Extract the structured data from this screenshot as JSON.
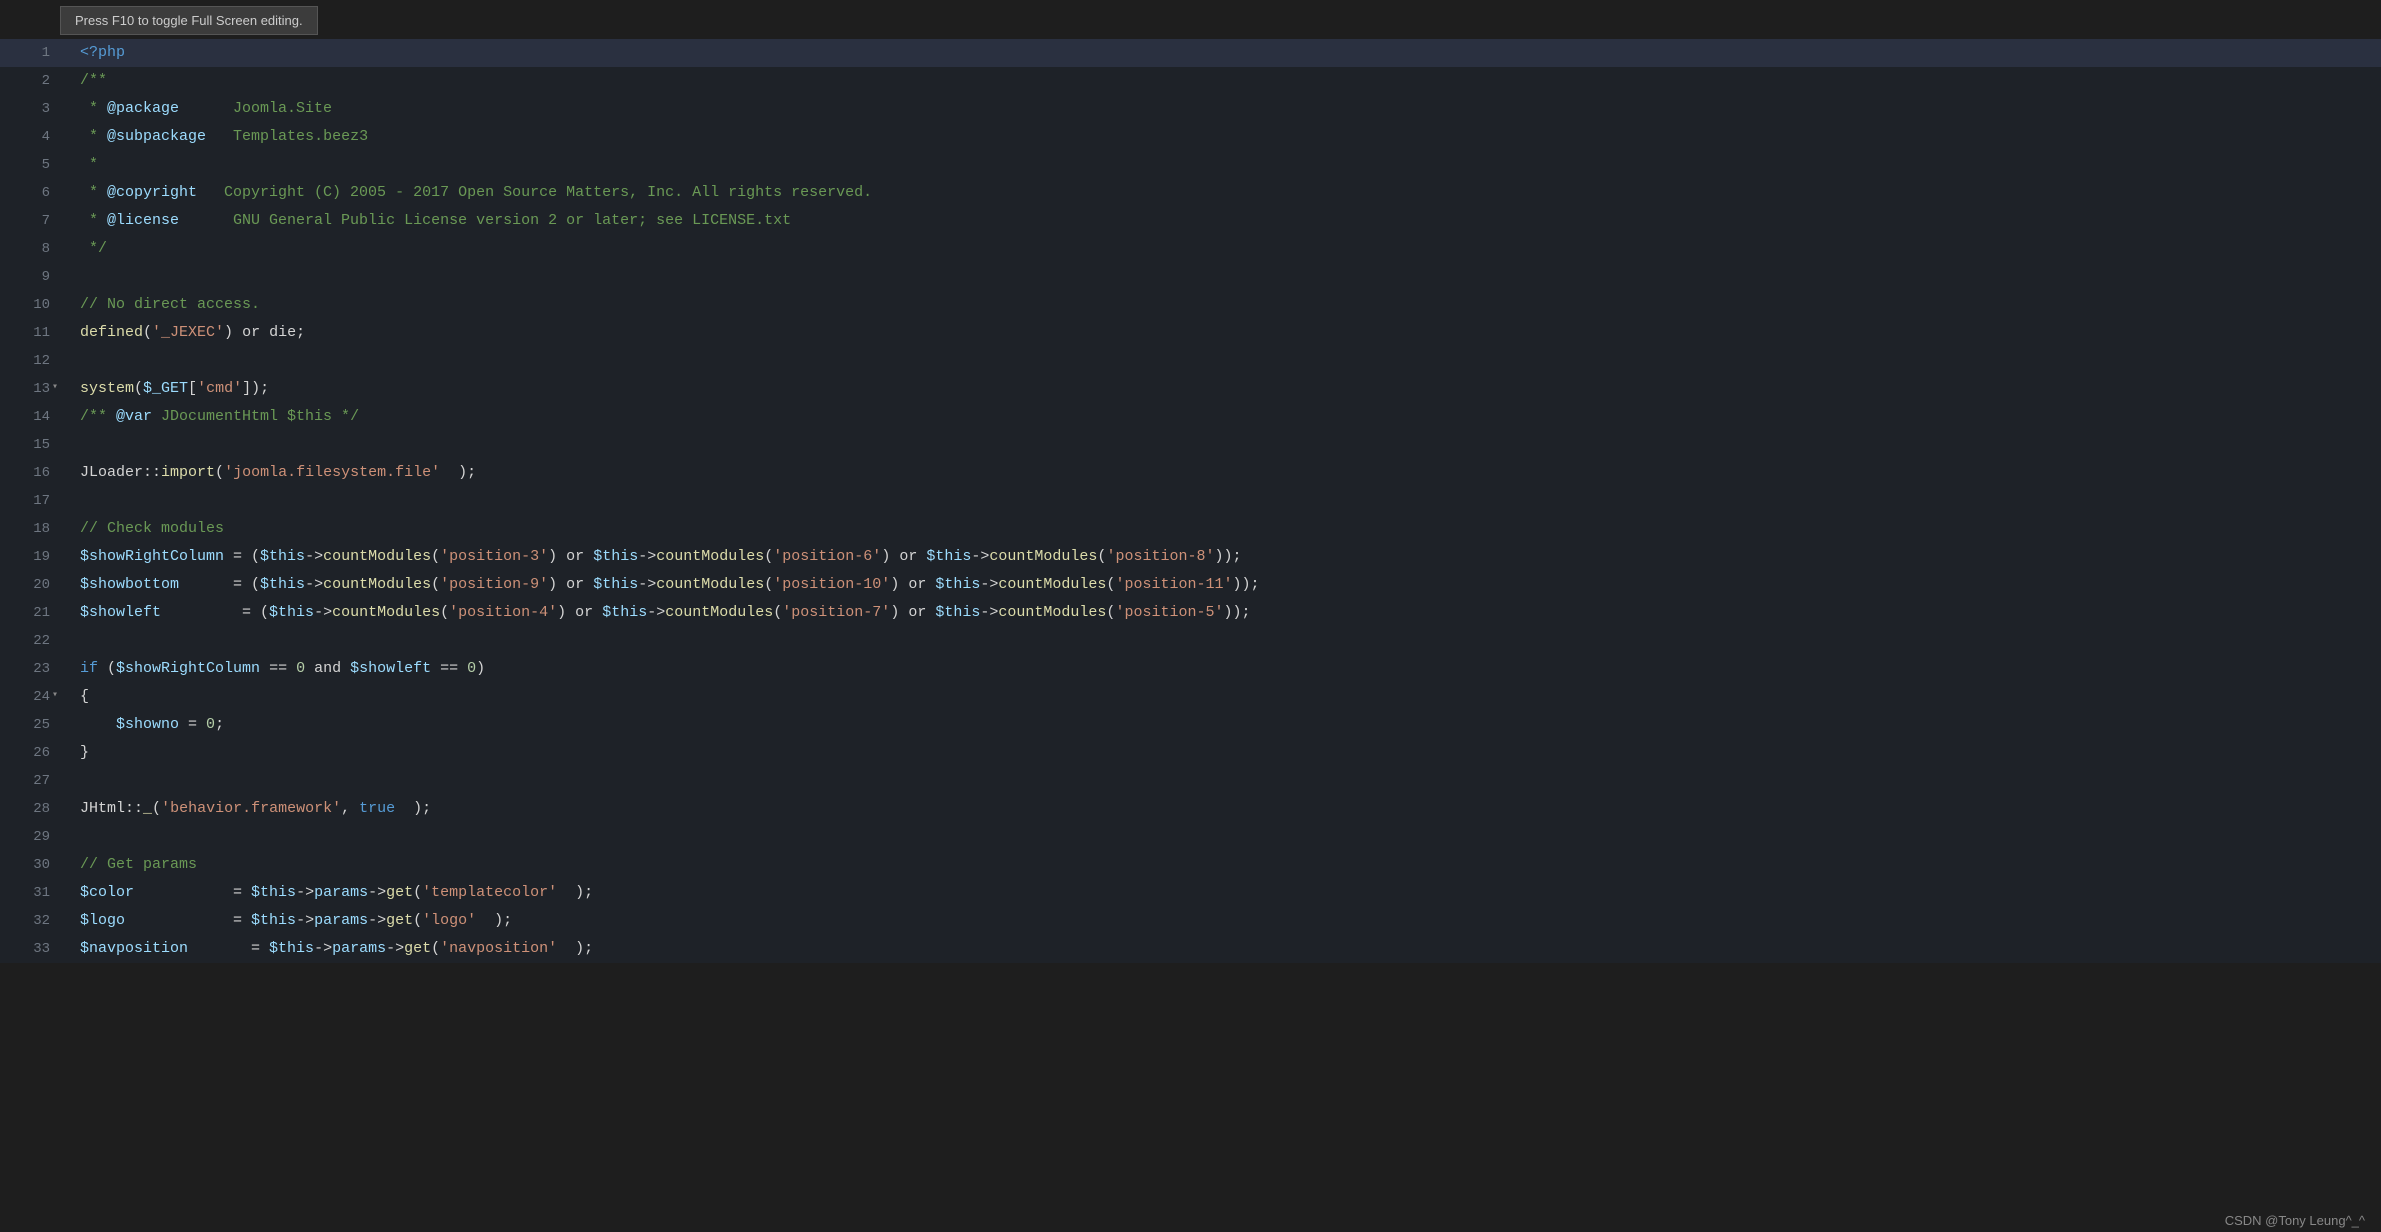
{
  "tooltip": {
    "text": "Press F10 to toggle Full Screen editing."
  },
  "statusbar": {
    "text": "CSDN @Tony Leung^_^"
  },
  "lines": [
    {
      "num": 1,
      "active": true,
      "tokens": [
        {
          "t": "<?php",
          "c": "php-tag"
        }
      ]
    },
    {
      "num": 2,
      "active": false,
      "tokens": [
        {
          "t": "/**",
          "c": "comment"
        }
      ]
    },
    {
      "num": 3,
      "active": false,
      "tokens": [
        {
          "t": " * ",
          "c": "comment"
        },
        {
          "t": "@package",
          "c": "annotation"
        },
        {
          "t": "      Joomla.Site",
          "c": "comment"
        }
      ]
    },
    {
      "num": 4,
      "active": false,
      "tokens": [
        {
          "t": " * ",
          "c": "comment"
        },
        {
          "t": "@subpackage",
          "c": "annotation"
        },
        {
          "t": "   Templates.beez3",
          "c": "comment"
        }
      ]
    },
    {
      "num": 5,
      "active": false,
      "tokens": [
        {
          "t": " *",
          "c": "comment"
        }
      ]
    },
    {
      "num": 6,
      "active": false,
      "tokens": [
        {
          "t": " * ",
          "c": "comment"
        },
        {
          "t": "@copyright",
          "c": "annotation"
        },
        {
          "t": "   Copyright (C) 2005 - 2017 Open Source Matters, Inc. All rights reserved.",
          "c": "comment"
        }
      ]
    },
    {
      "num": 7,
      "active": false,
      "tokens": [
        {
          "t": " * ",
          "c": "comment"
        },
        {
          "t": "@license",
          "c": "annotation"
        },
        {
          "t": "      GNU General Public License version 2 or later; see LICENSE.txt",
          "c": "comment"
        }
      ]
    },
    {
      "num": 8,
      "active": false,
      "tokens": [
        {
          "t": " */",
          "c": "comment"
        }
      ]
    },
    {
      "num": 9,
      "active": false,
      "tokens": []
    },
    {
      "num": 10,
      "active": false,
      "tokens": [
        {
          "t": "// No direct access.",
          "c": "comment-text"
        }
      ]
    },
    {
      "num": 11,
      "active": false,
      "tokens": [
        {
          "t": "defined",
          "c": "function-call"
        },
        {
          "t": "(",
          "c": "plain"
        },
        {
          "t": "'_JEXEC'",
          "c": "string"
        },
        {
          "t": ") ",
          "c": "plain"
        },
        {
          "t": "or",
          "c": "plain"
        },
        {
          "t": " die;",
          "c": "plain"
        }
      ]
    },
    {
      "num": 12,
      "active": false,
      "tokens": []
    },
    {
      "num": 13,
      "active": false,
      "fold": true,
      "tokens": [
        {
          "t": "system",
          "c": "function-call"
        },
        {
          "t": "(",
          "c": "plain"
        },
        {
          "t": "$_GET",
          "c": "variable"
        },
        {
          "t": "[",
          "c": "plain"
        },
        {
          "t": "'cmd'",
          "c": "string"
        },
        {
          "t": "]);",
          "c": "plain"
        }
      ]
    },
    {
      "num": 14,
      "active": false,
      "tokens": [
        {
          "t": "/** ",
          "c": "comment"
        },
        {
          "t": "@var",
          "c": "annotation"
        },
        {
          "t": " JDocumentHtml $this */",
          "c": "comment"
        }
      ]
    },
    {
      "num": 15,
      "active": false,
      "tokens": []
    },
    {
      "num": 16,
      "active": false,
      "tokens": [
        {
          "t": "JLoader",
          "c": "plain"
        },
        {
          "t": "::",
          "c": "plain"
        },
        {
          "t": "import",
          "c": "function-call"
        },
        {
          "t": "(",
          "c": "plain"
        },
        {
          "t": "'joomla.filesystem.file'",
          "c": "string"
        },
        {
          "t": "  );",
          "c": "plain"
        }
      ]
    },
    {
      "num": 17,
      "active": false,
      "tokens": []
    },
    {
      "num": 18,
      "active": false,
      "tokens": [
        {
          "t": "// Check modules",
          "c": "comment-text"
        }
      ]
    },
    {
      "num": 19,
      "active": false,
      "tokens": [
        {
          "t": "$showRightColumn",
          "c": "variable"
        },
        {
          "t": " = (",
          "c": "plain"
        },
        {
          "t": "$this",
          "c": "variable"
        },
        {
          "t": "->",
          "c": "plain"
        },
        {
          "t": "countModules",
          "c": "function-call"
        },
        {
          "t": "(",
          "c": "plain"
        },
        {
          "t": "'position-3'",
          "c": "string"
        },
        {
          "t": ") ",
          "c": "plain"
        },
        {
          "t": "or",
          "c": "plain"
        },
        {
          "t": " ",
          "c": "plain"
        },
        {
          "t": "$this",
          "c": "variable"
        },
        {
          "t": "->",
          "c": "plain"
        },
        {
          "t": "countModules",
          "c": "function-call"
        },
        {
          "t": "(",
          "c": "plain"
        },
        {
          "t": "'position-6'",
          "c": "string"
        },
        {
          "t": ") ",
          "c": "plain"
        },
        {
          "t": "or",
          "c": "plain"
        },
        {
          "t": " ",
          "c": "plain"
        },
        {
          "t": "$this",
          "c": "variable"
        },
        {
          "t": "->",
          "c": "plain"
        },
        {
          "t": "countModules",
          "c": "function-call"
        },
        {
          "t": "(",
          "c": "plain"
        },
        {
          "t": "'position-8'",
          "c": "string"
        },
        {
          "t": "));",
          "c": "plain"
        }
      ]
    },
    {
      "num": 20,
      "active": false,
      "tokens": [
        {
          "t": "$showbottom",
          "c": "variable"
        },
        {
          "t": "      = (",
          "c": "plain"
        },
        {
          "t": "$this",
          "c": "variable"
        },
        {
          "t": "->",
          "c": "plain"
        },
        {
          "t": "countModules",
          "c": "function-call"
        },
        {
          "t": "(",
          "c": "plain"
        },
        {
          "t": "'position-9'",
          "c": "string"
        },
        {
          "t": ") ",
          "c": "plain"
        },
        {
          "t": "or",
          "c": "plain"
        },
        {
          "t": " ",
          "c": "plain"
        },
        {
          "t": "$this",
          "c": "variable"
        },
        {
          "t": "->",
          "c": "plain"
        },
        {
          "t": "countModules",
          "c": "function-call"
        },
        {
          "t": "(",
          "c": "plain"
        },
        {
          "t": "'position-10'",
          "c": "string"
        },
        {
          "t": ") ",
          "c": "plain"
        },
        {
          "t": "or",
          "c": "plain"
        },
        {
          "t": " ",
          "c": "plain"
        },
        {
          "t": "$this",
          "c": "variable"
        },
        {
          "t": "->",
          "c": "plain"
        },
        {
          "t": "countModules",
          "c": "function-call"
        },
        {
          "t": "(",
          "c": "plain"
        },
        {
          "t": "'position-11'",
          "c": "string"
        },
        {
          "t": "));",
          "c": "plain"
        }
      ]
    },
    {
      "num": 21,
      "active": false,
      "tokens": [
        {
          "t": "$showleft",
          "c": "variable"
        },
        {
          "t": "         = (",
          "c": "plain"
        },
        {
          "t": "$this",
          "c": "variable"
        },
        {
          "t": "->",
          "c": "plain"
        },
        {
          "t": "countModules",
          "c": "function-call"
        },
        {
          "t": "(",
          "c": "plain"
        },
        {
          "t": "'position-4'",
          "c": "string"
        },
        {
          "t": ") ",
          "c": "plain"
        },
        {
          "t": "or",
          "c": "plain"
        },
        {
          "t": " ",
          "c": "plain"
        },
        {
          "t": "$this",
          "c": "variable"
        },
        {
          "t": "->",
          "c": "plain"
        },
        {
          "t": "countModules",
          "c": "function-call"
        },
        {
          "t": "(",
          "c": "plain"
        },
        {
          "t": "'position-7'",
          "c": "string"
        },
        {
          "t": ") ",
          "c": "plain"
        },
        {
          "t": "or",
          "c": "plain"
        },
        {
          "t": " ",
          "c": "plain"
        },
        {
          "t": "$this",
          "c": "variable"
        },
        {
          "t": "->",
          "c": "plain"
        },
        {
          "t": "countModules",
          "c": "function-call"
        },
        {
          "t": "(",
          "c": "plain"
        },
        {
          "t": "'position-5'",
          "c": "string"
        },
        {
          "t": "));",
          "c": "plain"
        }
      ]
    },
    {
      "num": 22,
      "active": false,
      "tokens": []
    },
    {
      "num": 23,
      "active": false,
      "tokens": [
        {
          "t": "if",
          "c": "blue-kw"
        },
        {
          "t": " (",
          "c": "plain"
        },
        {
          "t": "$showRightColumn",
          "c": "variable"
        },
        {
          "t": " == ",
          "c": "plain"
        },
        {
          "t": "0",
          "c": "number"
        },
        {
          "t": " and ",
          "c": "plain"
        },
        {
          "t": "$showleft",
          "c": "variable"
        },
        {
          "t": " == ",
          "c": "plain"
        },
        {
          "t": "0",
          "c": "number"
        },
        {
          "t": ")",
          "c": "plain"
        }
      ]
    },
    {
      "num": 24,
      "active": false,
      "fold": true,
      "tokens": [
        {
          "t": "{",
          "c": "plain"
        }
      ]
    },
    {
      "num": 25,
      "active": false,
      "tokens": [
        {
          "t": "    ",
          "c": "plain"
        },
        {
          "t": "$showno",
          "c": "variable"
        },
        {
          "t": " = ",
          "c": "plain"
        },
        {
          "t": "0",
          "c": "number"
        },
        {
          "t": ";",
          "c": "plain"
        }
      ]
    },
    {
      "num": 26,
      "active": false,
      "tokens": [
        {
          "t": "}",
          "c": "plain"
        }
      ]
    },
    {
      "num": 27,
      "active": false,
      "tokens": []
    },
    {
      "num": 28,
      "active": false,
      "tokens": [
        {
          "t": "JHtml",
          "c": "plain"
        },
        {
          "t": "::",
          "c": "plain"
        },
        {
          "t": "_",
          "c": "function-call"
        },
        {
          "t": "(",
          "c": "plain"
        },
        {
          "t": "'behavior.framework'",
          "c": "string"
        },
        {
          "t": ", ",
          "c": "plain"
        },
        {
          "t": "true",
          "c": "bool-val"
        },
        {
          "t": "  );",
          "c": "plain"
        }
      ]
    },
    {
      "num": 29,
      "active": false,
      "tokens": []
    },
    {
      "num": 30,
      "active": false,
      "tokens": [
        {
          "t": "// Get params",
          "c": "comment-text"
        }
      ]
    },
    {
      "num": 31,
      "active": false,
      "tokens": [
        {
          "t": "$color",
          "c": "variable"
        },
        {
          "t": "           = ",
          "c": "plain"
        },
        {
          "t": "$this",
          "c": "variable"
        },
        {
          "t": "->",
          "c": "plain"
        },
        {
          "t": "params",
          "c": "variable"
        },
        {
          "t": "->",
          "c": "plain"
        },
        {
          "t": "get",
          "c": "function-call"
        },
        {
          "t": "(",
          "c": "plain"
        },
        {
          "t": "'templatecolor'",
          "c": "string"
        },
        {
          "t": "  );",
          "c": "plain"
        }
      ]
    },
    {
      "num": 32,
      "active": false,
      "tokens": [
        {
          "t": "$logo",
          "c": "variable"
        },
        {
          "t": "            = ",
          "c": "plain"
        },
        {
          "t": "$this",
          "c": "variable"
        },
        {
          "t": "->",
          "c": "plain"
        },
        {
          "t": "params",
          "c": "variable"
        },
        {
          "t": "->",
          "c": "plain"
        },
        {
          "t": "get",
          "c": "function-call"
        },
        {
          "t": "(",
          "c": "plain"
        },
        {
          "t": "'logo'",
          "c": "string"
        },
        {
          "t": "  );",
          "c": "plain"
        }
      ]
    },
    {
      "num": 33,
      "active": false,
      "tokens": [
        {
          "t": "$navposition",
          "c": "variable"
        },
        {
          "t": "       = ",
          "c": "plain"
        },
        {
          "t": "$this",
          "c": "variable"
        },
        {
          "t": "->",
          "c": "plain"
        },
        {
          "t": "params",
          "c": "variable"
        },
        {
          "t": "->",
          "c": "plain"
        },
        {
          "t": "get",
          "c": "function-call"
        },
        {
          "t": "(",
          "c": "plain"
        },
        {
          "t": "'navposition'",
          "c": "string"
        },
        {
          "t": "  );",
          "c": "plain"
        }
      ]
    }
  ]
}
